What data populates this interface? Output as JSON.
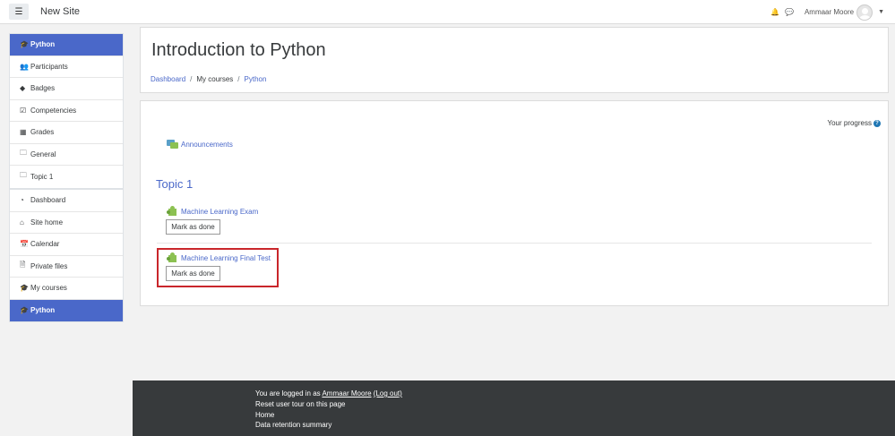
{
  "navbar": {
    "site_name": "New Site",
    "user_name": "Ammaar Moore"
  },
  "drawer": {
    "course_items": [
      {
        "label": "Python",
        "icon": "graduation-cap-icon",
        "active": true
      },
      {
        "label": "Participants",
        "icon": "users-icon",
        "active": false
      },
      {
        "label": "Badges",
        "icon": "shield-icon",
        "active": false
      },
      {
        "label": "Competencies",
        "icon": "check-square-icon",
        "active": false
      },
      {
        "label": "Grades",
        "icon": "table-icon",
        "active": false
      },
      {
        "label": "General",
        "icon": "folder-icon",
        "active": false
      },
      {
        "label": "Topic 1",
        "icon": "folder-icon",
        "active": false
      }
    ],
    "site_items": [
      {
        "label": "Dashboard",
        "icon": "dashboard-icon",
        "active": false
      },
      {
        "label": "Site home",
        "icon": "home-icon",
        "active": false
      },
      {
        "label": "Calendar",
        "icon": "calendar-icon",
        "active": false
      },
      {
        "label": "Private files",
        "icon": "file-icon",
        "active": false
      },
      {
        "label": "My courses",
        "icon": "graduation-cap-icon",
        "active": false
      },
      {
        "label": "Python",
        "icon": "graduation-cap-icon",
        "active": true
      }
    ]
  },
  "header": {
    "title": "Introduction to Python",
    "breadcrumb": [
      "Dashboard",
      "My courses",
      "Python"
    ]
  },
  "course": {
    "progress_label": "Your progress",
    "announcements": "Announcements",
    "section_title": "Topic 1",
    "activities": [
      {
        "name": "Machine Learning Exam",
        "button": "Mark as done"
      },
      {
        "name": "Machine Learning Final Test",
        "button": "Mark as done"
      }
    ]
  },
  "footer": {
    "logged_in_prefix": "You are logged in as ",
    "logged_in_user": "Ammaar Moore",
    "logout": "(Log out)",
    "reset_tour": "Reset user tour on this page",
    "home": "Home",
    "data_retention": "Data retention summary"
  },
  "colors": {
    "accent": "#4a68c9",
    "highlight": "#c9262b",
    "footer_bg": "#373a3c"
  }
}
